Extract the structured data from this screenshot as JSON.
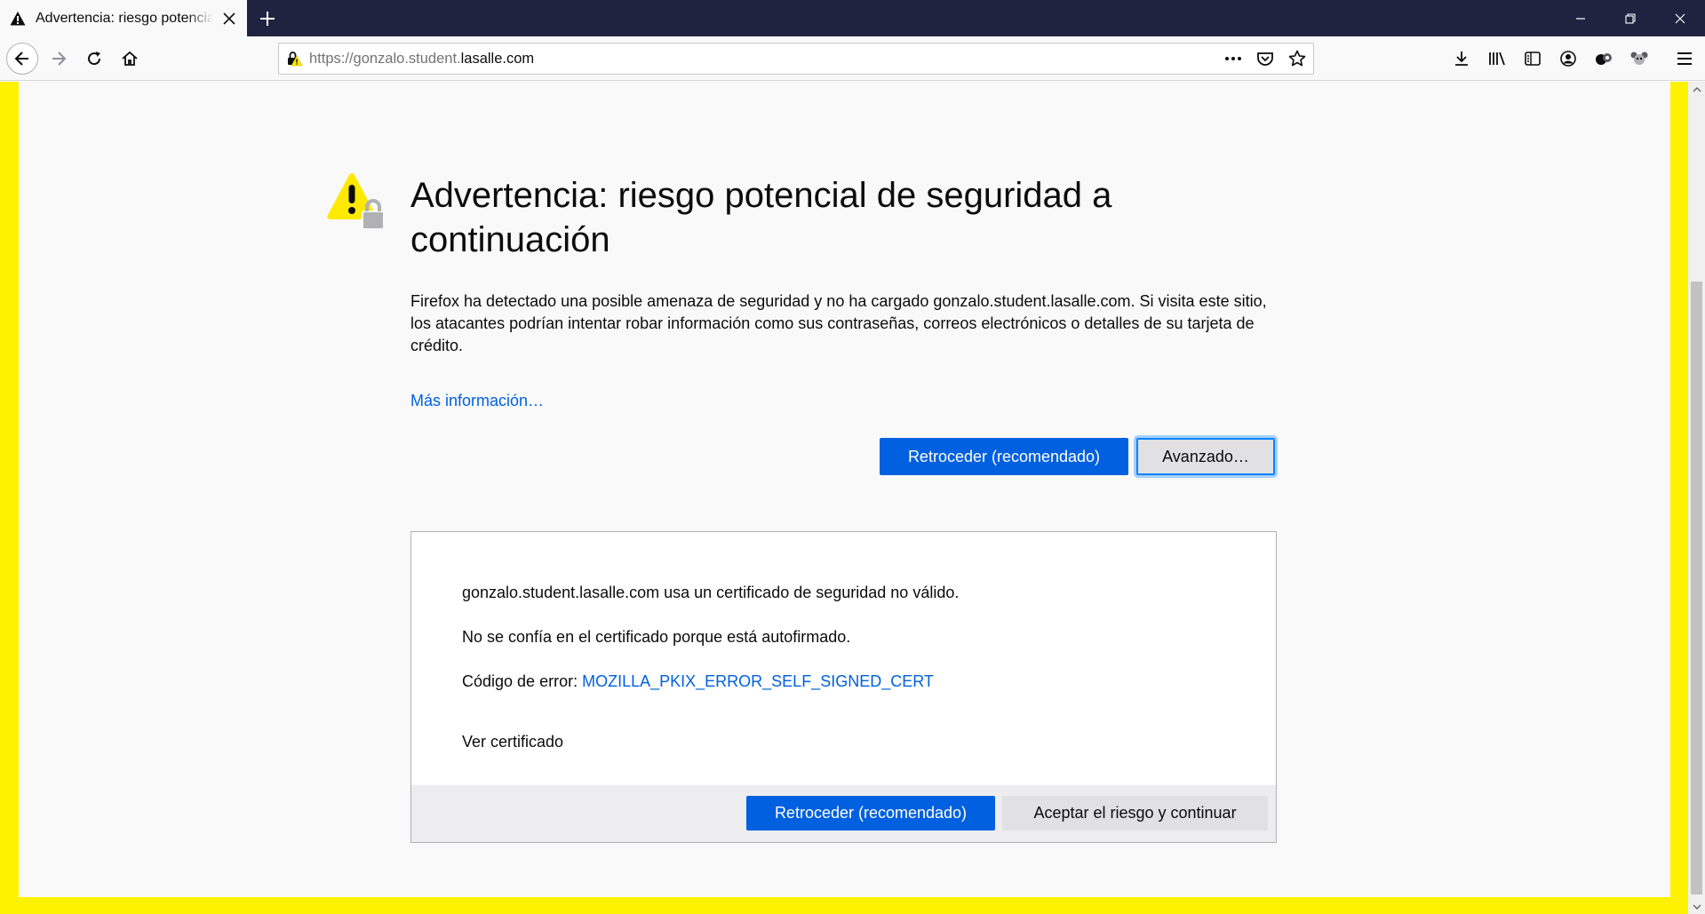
{
  "browser": {
    "tab": {
      "title": "Advertencia: riesgo potencial de seguridad a continuación"
    },
    "url": {
      "prefix": "https://gonzalo.student.",
      "domain": "lasalle.com"
    }
  },
  "page": {
    "title": "Advertencia: riesgo potencial de seguridad a continuación",
    "description": "Firefox ha detectado una posible amenaza de seguridad y no ha cargado gonzalo.student.lasalle.com. Si visita este sitio, los atacantes podrían intentar robar información como sus contraseñas, correos electrónicos o detalles de su tarjeta de crédito.",
    "more_info": "Más información…",
    "go_back_label": "Retroceder (recomendado)",
    "advanced_label": "Avanzado…",
    "advanced": {
      "line1": "gonzalo.student.lasalle.com usa un certificado de seguridad no válido.",
      "line2": "No se confía en el certificado porque está autofirmado.",
      "error_prefix": "Código de error:",
      "error_code": "MOZILLA_PKIX_ERROR_SELF_SIGNED_CERT",
      "view_certificate": "Ver certificado",
      "go_back_label": "Retroceder (recomendado)",
      "accept_label": "Aceptar el riesgo y continuar"
    }
  },
  "colors": {
    "accent": "#0060df",
    "frame": "#fef200",
    "titlebar": "#202340",
    "warning": "#ffe900"
  }
}
